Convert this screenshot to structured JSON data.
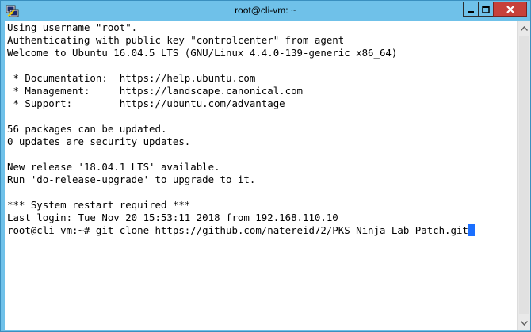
{
  "window": {
    "title": "root@cli-vm: ~",
    "accent_color": "#6fc1e9",
    "close_color": "#c7413a",
    "icon": "putty-terminal-icon"
  },
  "controls": {
    "minimize_icon": "minimize-icon",
    "maximize_icon": "maximize-icon",
    "close_icon": "close-icon"
  },
  "terminal": {
    "lines": [
      "Using username \"root\".",
      "Authenticating with public key \"controlcenter\" from agent",
      "Welcome to Ubuntu 16.04.5 LTS (GNU/Linux 4.4.0-139-generic x86_64)",
      "",
      " * Documentation:  https://help.ubuntu.com",
      " * Management:     https://landscape.canonical.com",
      " * Support:        https://ubuntu.com/advantage",
      "",
      "56 packages can be updated.",
      "0 updates are security updates.",
      "",
      "New release '18.04.1 LTS' available.",
      "Run 'do-release-upgrade' to upgrade to it.",
      "",
      "*** System restart required ***",
      "Last login: Tue Nov 20 15:53:11 2018 from 192.168.110.10"
    ],
    "prompt": "root@cli-vm:~# ",
    "command": "git clone https://github.com/natereid72/PKS-Ninja-Lab-Patch.git",
    "cursor_color": "#1a6fff"
  }
}
